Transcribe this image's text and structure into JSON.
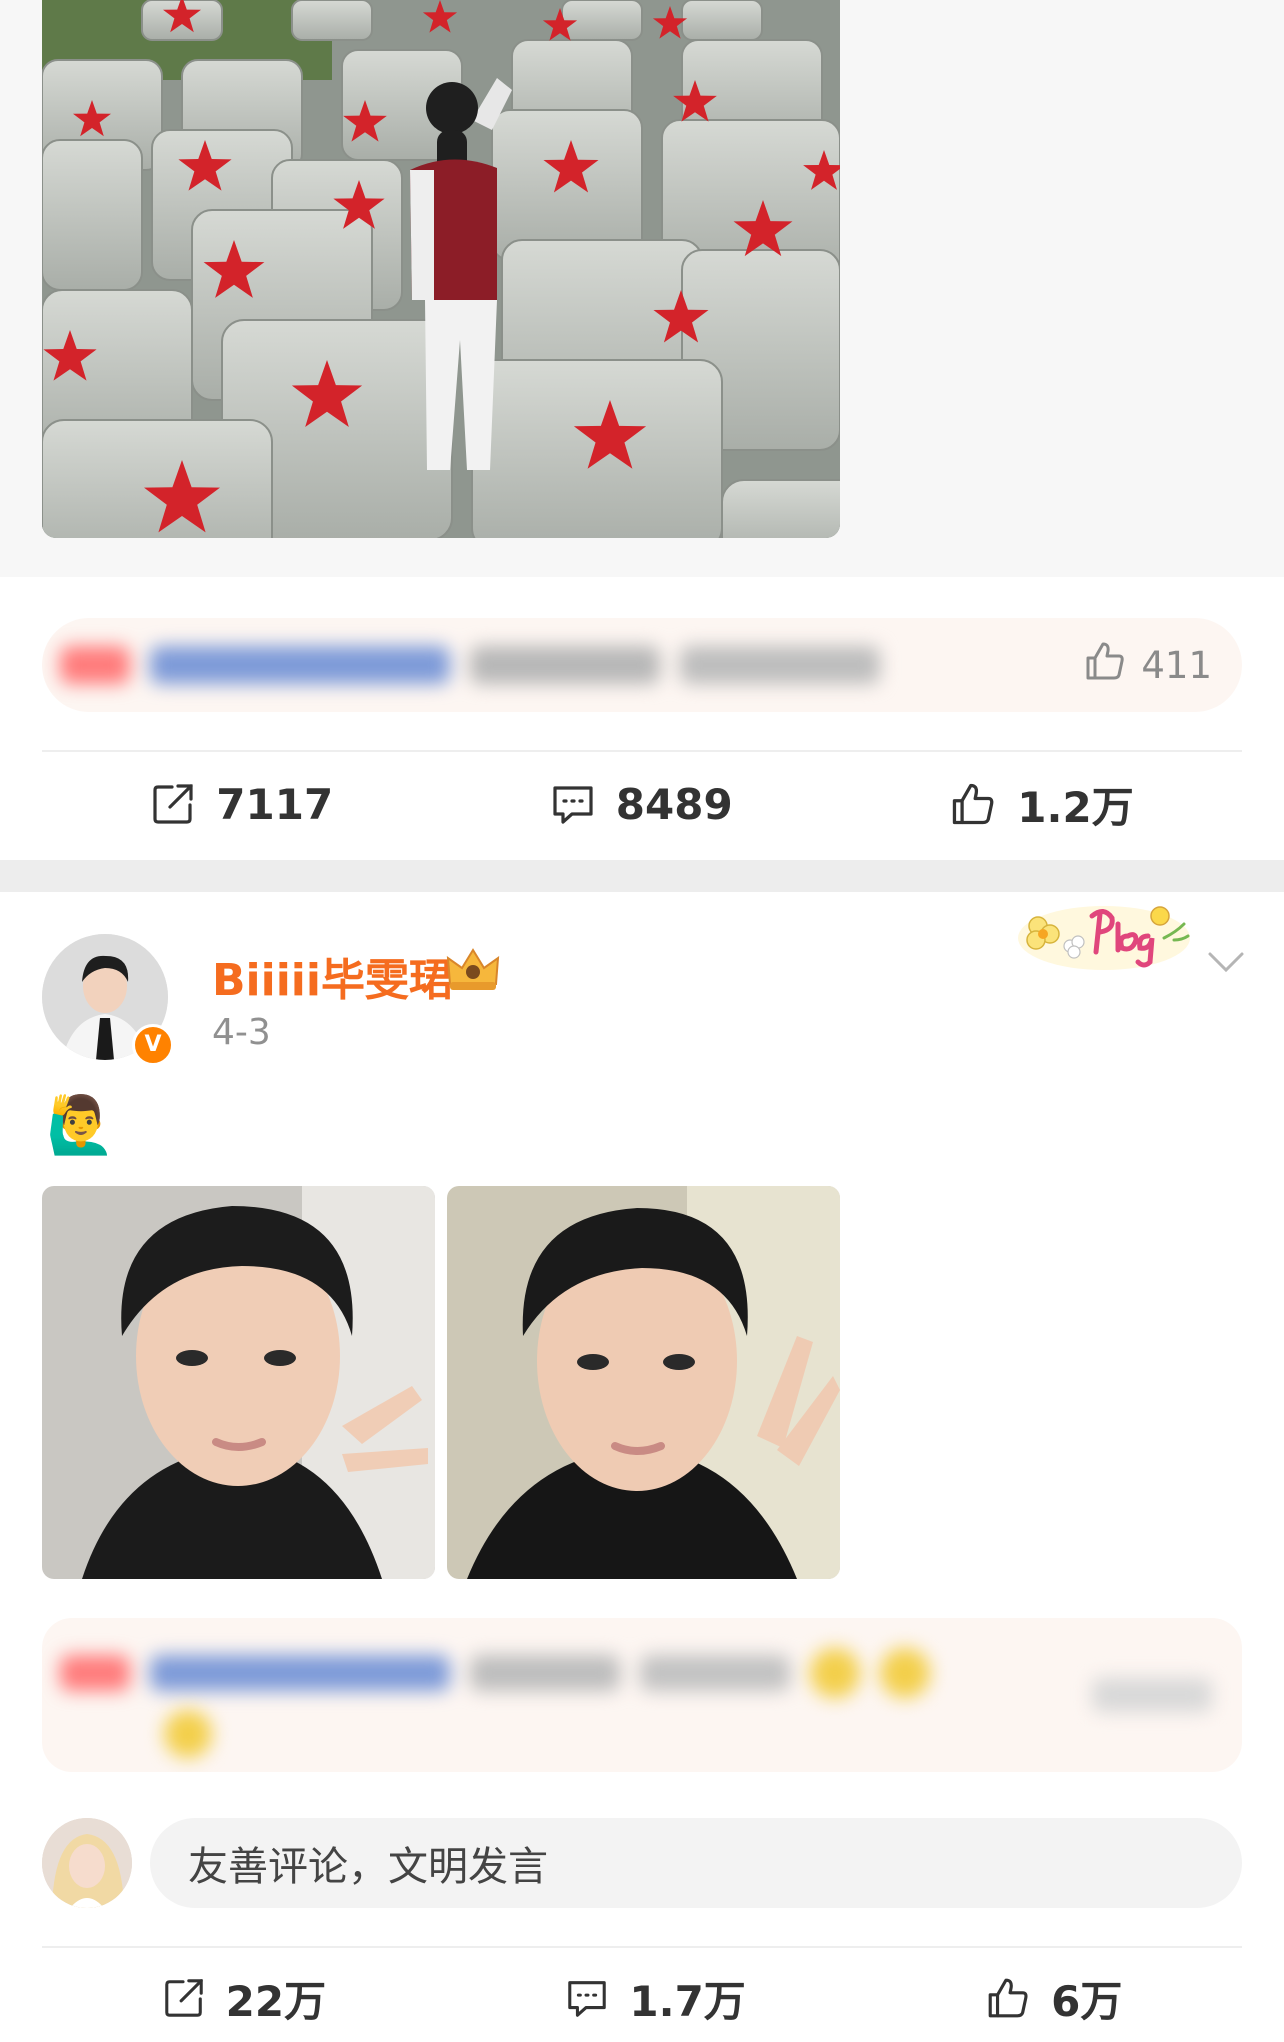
{
  "post1": {
    "hot_comment": {
      "like_count": "411"
    },
    "actions": {
      "repost": "7117",
      "comment": "8489",
      "like": "1.2万"
    }
  },
  "post2": {
    "user": {
      "name": "Biiiii毕雯珺",
      "verified_badge": "V"
    },
    "date": "4-3",
    "text": "🙋‍♂️",
    "comment_input": {
      "placeholder": "友善评论，文明发言"
    },
    "actions": {
      "repost": "22万",
      "comment": "1.7万",
      "like": "6万"
    }
  },
  "colors": {
    "username": "#f56c1f",
    "verified": "#ff8200",
    "star_red": "#d3232a",
    "hot_comment_bg": "#fdf6f2"
  },
  "icons": [
    "repost-icon",
    "comment-icon",
    "like-icon",
    "chevron-down-icon",
    "crown-icon"
  ]
}
